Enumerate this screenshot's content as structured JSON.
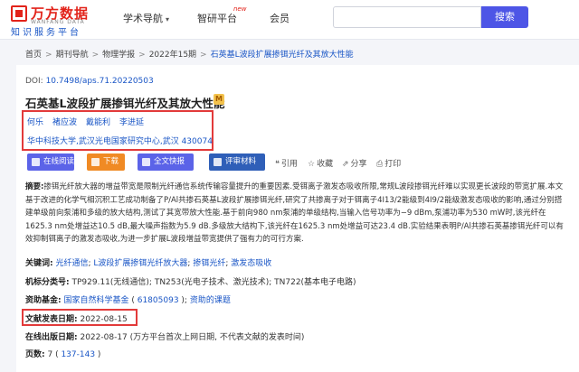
{
  "header": {
    "logo_cn": "万方数据",
    "logo_en": "WANFANG DATA",
    "logo_sub": "知识服务平台",
    "nav": [
      "学术导航",
      "智研平台",
      "会员"
    ],
    "new_badge": "new",
    "search_button": "搜索",
    "search_placeholder": ""
  },
  "breadcrumb": [
    "首页",
    "期刊导航",
    "物理学报",
    "2022年15期",
    "石英基L波段扩展掺铒光纤及其放大性能"
  ],
  "article": {
    "doi_label": "DOI:",
    "doi": "10.7498/aps.71.20220503",
    "title": "石英基L波段扩展掺铒光纤及其放大性能",
    "title_icon": "M",
    "authors": [
      "何乐",
      "褚应波",
      "戴能利",
      "李进延"
    ],
    "affiliation": "华中科技大学,武汉光电国家研究中心,武汉 430074",
    "buttons": {
      "read": "在线阅读",
      "download": "下载",
      "fulltext": "全文快报",
      "evaluate": "评审材料"
    },
    "actions": {
      "cite": "引用",
      "favorite": "收藏",
      "share": "分享",
      "print": "打印"
    },
    "abstract_label": "摘要:",
    "abstract_text": "掺铒光纤放大器的增益带宽是限制光纤通信系统传输容量提升的重要因素.受铒离子激发态吸收所限,常规L波段掺铒光纤难以实现更长波段的带宽扩展.本文基于改进的化学气相沉积工艺成功制备了P/Al共掺石英基L波段扩展掺铒光纤,研究了共掺离子对于铒离子4I13/2能级到4I9/2能级激发态吸收的影响,通过分别搭建单级前向泵浦和多级的放大结构,测试了其宽带放大性能.基于前向980 nm泵浦的单级结构,当输入信号功率为−9 dBm,泵浦功率为530 mW时,该光纤在1625.3 nm处增益达10.5 dB,最大噪声指数为5.9 dB.多级放大结构下,该光纤在1625.3 nm处增益可达23.4 dB.实验结果表明P/Al共掺石英基掺铒光纤可以有效抑制铒离子的激发态吸收,为进一步扩展L波段增益带宽提供了强有力的可行方案.",
    "keywords_label": "关键词:",
    "keywords": [
      "光纤通信",
      "L波段扩展掺铒光纤放大器",
      "掺铒光纤",
      "激发态吸收"
    ],
    "classification_label": "机标分类号:",
    "classification": "TP929.11(无线通信); TN253(光电子技术、激光技术); TN722(基本电子电路)",
    "funding_label": "资助基金:",
    "funding": "国家自然科学基金",
    "funding_code": "61805093",
    "funding_project": "资助的课题",
    "pubdate_label": "文献发表日期:",
    "pubdate": "2022-08-15",
    "online_label": "在线出版日期:",
    "online_date": "2022-08-17",
    "online_note": "(万方平台首次上网日期, 不代表文献的发表时间)",
    "pages_label": "页数:",
    "pages": "7",
    "page_range": "137-143"
  },
  "colors": {
    "accent": "#4d55e6",
    "link": "#1a56c6",
    "brand": "#e2231a",
    "highlight_box": "#e23a3a",
    "download": "#f08a24"
  }
}
